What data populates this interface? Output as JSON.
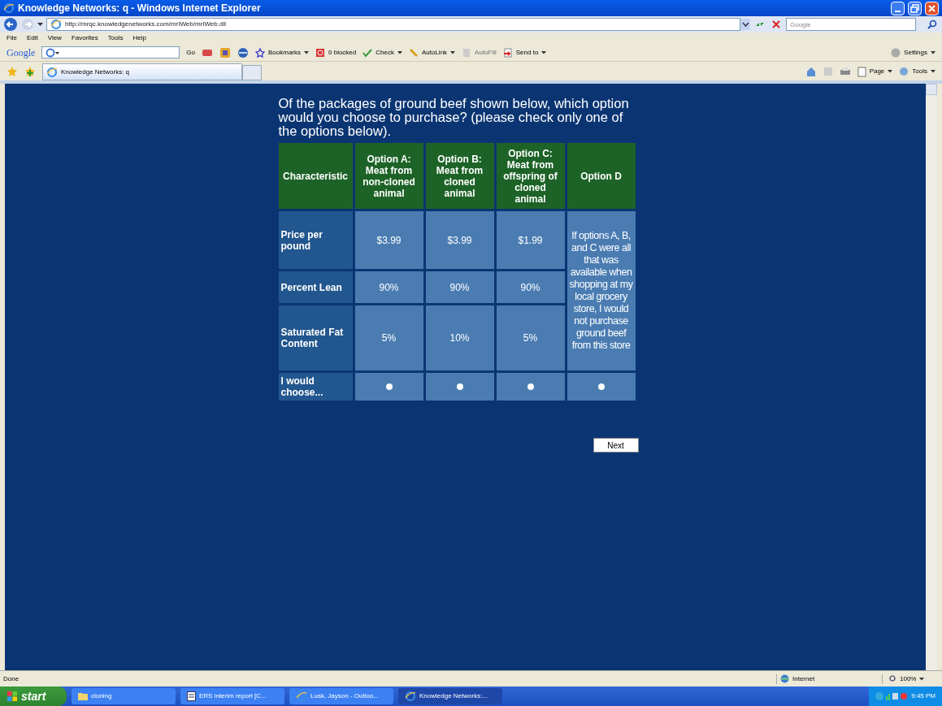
{
  "window": {
    "title": "Knowledge Networks: q - Windows Internet Explorer"
  },
  "address_bar": {
    "url": "http://mrqc.knowledgenetworks.com/mrIWeb/mrIWeb.dll",
    "search_placeholder": "Google"
  },
  "menu": [
    "File",
    "Edit",
    "View",
    "Favorites",
    "Tools",
    "Help"
  ],
  "google_toolbar": {
    "logo": "Google",
    "go": "Go",
    "items": [
      {
        "label": "Bookmarks",
        "dropdown": true,
        "disabled": false
      },
      {
        "label": "0 blocked",
        "dropdown": false,
        "disabled": false
      },
      {
        "label": "Check",
        "dropdown": true,
        "disabled": false
      },
      {
        "label": "AutoLink",
        "dropdown": true,
        "disabled": false
      },
      {
        "label": "AutoFill",
        "dropdown": false,
        "disabled": true
      },
      {
        "label": "Send to",
        "dropdown": true,
        "disabled": false
      }
    ],
    "settings": "Settings"
  },
  "tab": {
    "label": "Knowledge Networks: q"
  },
  "command_bar": [
    "Page",
    "Tools"
  ],
  "question": "Of the packages of ground beef shown below, which option would you choose to purchase? (please check only one of the options below).",
  "table": {
    "columns": [
      "Characteristic",
      "Option A: Meat from non-cloned animal",
      "Option B: Meat from cloned animal",
      "Option C: Meat from offspring of cloned animal",
      "Option D"
    ],
    "rows": [
      {
        "label": "Price per pound",
        "values": [
          "$3.99",
          "$3.99",
          "$1.99"
        ]
      },
      {
        "label": "Percent Lean",
        "values": [
          "90%",
          "90%",
          "90%"
        ]
      },
      {
        "label": "Saturated Fat Content",
        "values": [
          "5%",
          "10%",
          "5%"
        ]
      }
    ],
    "option_d_note": "If options A, B, and C were all that was available when shopping at my local grocery store, I would not purchase ground beef from this store",
    "choice_row": {
      "label": "I would choose...",
      "options": [
        {
          "selected": false
        },
        {
          "selected": false
        },
        {
          "selected": false
        },
        {
          "selected": false
        }
      ]
    }
  },
  "next_button": "Next",
  "status_bar": {
    "status": "Done",
    "zone": "Internet",
    "zoom": "100%"
  },
  "taskbar": {
    "start": "start",
    "items": [
      {
        "label": "cloning",
        "kind": "folder",
        "selected": false
      },
      {
        "label": "ERS interim report [C...",
        "kind": "document",
        "selected": false
      },
      {
        "label": "Lusk, Jayson - Outloo...",
        "kind": "browser",
        "selected": false
      },
      {
        "label": "Knowledge Networks:...",
        "kind": "browser",
        "selected": true
      }
    ],
    "clock": "9:45 PM"
  }
}
